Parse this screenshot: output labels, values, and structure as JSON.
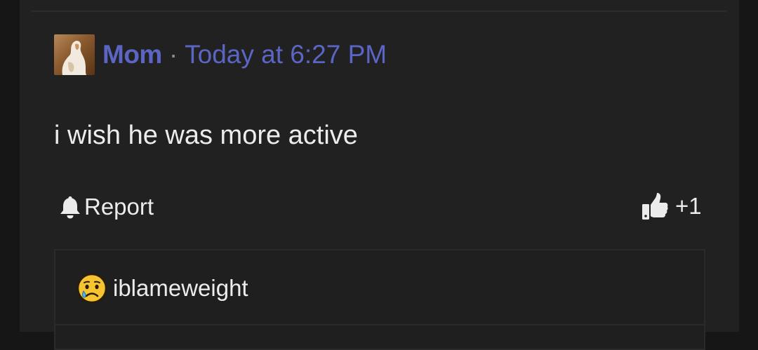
{
  "post": {
    "author": "Mom",
    "separator": "·",
    "timestamp": "Today at 6:27 PM",
    "body": "i wish he was more active"
  },
  "actions": {
    "report_label": "Report",
    "like_count": "+1"
  },
  "reply": {
    "username": "iblameweight"
  },
  "colors": {
    "accent": "#5b66c4",
    "background": "#212121",
    "text": "#ececec"
  },
  "icons": {
    "report": "bell-icon",
    "like": "thumbs-up-icon",
    "reply_avatar": "crying-face-emoji-icon"
  }
}
